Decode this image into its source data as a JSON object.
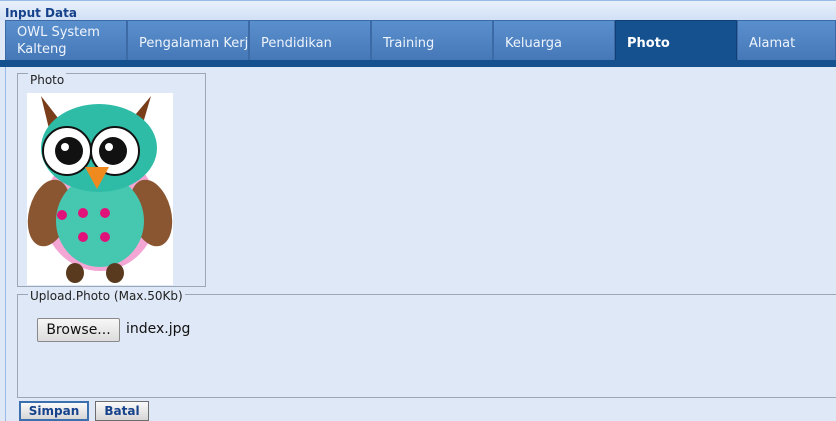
{
  "window": {
    "title": "Input Data"
  },
  "tabs": [
    {
      "label": "OWL System Kalteng"
    },
    {
      "label": "Pengalaman Kerja"
    },
    {
      "label": "Pendidikan"
    },
    {
      "label": "Training"
    },
    {
      "label": "Keluarga"
    },
    {
      "label": "Photo",
      "active": true
    },
    {
      "label": "Alamat"
    }
  ],
  "photo_section": {
    "legend": "Photo",
    "image_alt": "owl-image"
  },
  "upload_section": {
    "legend": "Upload.Photo (Max.50Kb)",
    "browse_label": "Browse...",
    "file_name": "index.jpg"
  },
  "actions": {
    "save_label": "Simpan",
    "cancel_label": "Batal"
  },
  "colors": {
    "background": "#dfe8f6",
    "tab": "#4678b8",
    "tab_active": "#15508f",
    "title_text": "#15428b"
  }
}
